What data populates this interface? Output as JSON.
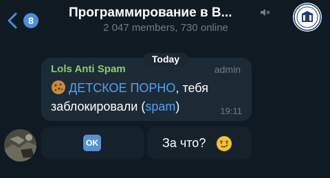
{
  "header": {
    "unread_count": "8",
    "title": "Программирование в В...",
    "subtitle": "2 047 members, 730 online"
  },
  "date_pill": "Today",
  "message": {
    "sender": "Lols Anti Spam",
    "role": "admin",
    "link_text": "ДЕТСКОЕ ПОРНО",
    "text_mid": ", тебя заблокировали (",
    "spam_link": "spam",
    "text_end": ")",
    "time": "19:11"
  },
  "keyboard": {
    "ok_label": "OK",
    "why_label": "За что?"
  },
  "colors": {
    "background": "#0f1a23",
    "accent": "#4b8fd6",
    "sender": "#8ecc66",
    "link": "#4fa3f7",
    "bubble": "#1c2a36"
  },
  "icons": [
    "back-arrow-icon",
    "mute-icon",
    "cookie-emoji-icon",
    "ok-emoji-icon",
    "smirk-emoji-icon"
  ]
}
